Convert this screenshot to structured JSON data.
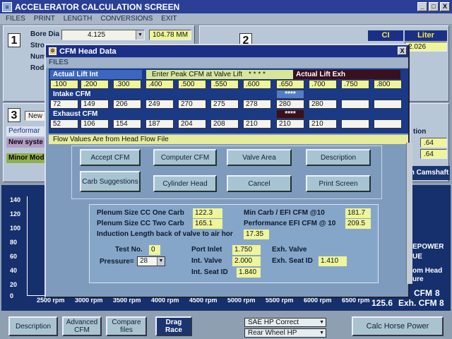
{
  "window": {
    "title": "ACCELERATOR CALCULATION SCREEN",
    "controls": {
      "minimize": "_",
      "maximize": "□",
      "close": "X"
    }
  },
  "menu": [
    "FILES",
    "PRINT",
    "LENGTH",
    "CONVERSIONS",
    "EXIT"
  ],
  "section1": {
    "number": "1",
    "bore_label": "Bore Dia",
    "bore_value": "4.125",
    "bore_mm": "104.78 MM",
    "partial_labels": [
      "Stro",
      "Num",
      "Rod"
    ]
  },
  "section2": {
    "number": "2",
    "ci_header": "CI",
    "liter_header": "Liter",
    "liter_value": "2.026"
  },
  "section3": {
    "number": "3",
    "new_label": "New",
    "tabs": [
      "Performar",
      "New syste"
    ],
    "minor_label": "Minor",
    "mod_label": "Mod"
  },
  "right_panel": {
    "partial_label": "tion",
    "values": [
      ".64",
      ".64"
    ],
    "camshaft_label": "n Camshaft"
  },
  "graph": {
    "y_ticks": [
      "140",
      "120",
      "100",
      "80",
      "60",
      "40",
      "20",
      "0"
    ],
    "x_ticks": [
      "2500 rpm",
      "3000 rpm",
      "3500 rpm",
      "4000 rpm",
      "4500 rpm",
      "5000 rpm",
      "5500 rpm",
      "6000 rpm",
      "6500 rpm"
    ],
    "right_texts": [
      "EPOWER",
      "UE",
      "om Head",
      "ure"
    ],
    "cfm_rows": [
      {
        "label": "CFM",
        "value": "8"
      },
      {
        "num": "125.6",
        "label": "Exh. CFM",
        "value": "8"
      }
    ]
  },
  "bottom_bar": {
    "description": "Description",
    "advanced_cfm": "Advanced CFM",
    "compare_files": "Compare files",
    "drag_race": "Drag Race",
    "sae_select": "SAE HP Correct",
    "wheel_select": "Rear Wheel  HP",
    "calc_hp": "Calc Horse Power"
  },
  "dialog": {
    "title": "CFM Head Data",
    "close": "X",
    "menu": "FILES",
    "flow": {
      "lift_int_label": "Actual Lift Int",
      "prompt": "Enter Peak CFM at Valve Lift",
      "stars": "* * * *",
      "lift_exh_label": "Actual Lift Exh",
      "lifts": [
        ".100",
        ".200",
        ".300",
        ".400",
        ".500",
        ".550",
        ".600",
        ".650",
        ".700",
        ".750",
        ".800"
      ],
      "intake_label": "Intake CFM",
      "intake": [
        "72",
        "149",
        "206",
        "249",
        "270",
        "275",
        "278",
        "280",
        "280",
        "",
        ""
      ],
      "intake_marker": "****",
      "exhaust_label": "Exhaust CFM",
      "exhaust": [
        "52",
        "106",
        "154",
        "187",
        "204",
        "208",
        "210",
        "210",
        "210",
        "",
        ""
      ],
      "exhaust_marker": "****"
    },
    "note": "Flow Values Are from Head Flow File",
    "buttons": {
      "accept": "Accept CFM",
      "computer": "Computer CFM",
      "valve_area": "Valve Area",
      "description": "Description",
      "carb": "Carb Suggestions",
      "cylinder_head": "Cylinder Head",
      "cancel": "Cancel",
      "print": "Print Screen"
    },
    "info": {
      "plenum_one_label": "Plenum Size CC One Carb",
      "plenum_one": "122.3",
      "plenum_two_label": "Plenum Size CC Two Carb",
      "plenum_two": "165.1",
      "min_carb_label": "Min Carb / EFI CFM @10",
      "min_carb": "181.7",
      "perf_efi_label": "Performance EFI CFM @ 10",
      "perf_efi": "209.5",
      "induction_label": "Induction Length back of valve to air hor",
      "induction": "17.35",
      "test_label": "Test No.",
      "test_no": "0",
      "pressure_label": "Pressure=",
      "pressure": "28",
      "port_inlet_label": "Port Inlet",
      "port_inlet": "1.750",
      "int_valve_label": "Int. Valve",
      "int_valve": "2.000",
      "int_seat_label": "Int. Seat ID",
      "int_seat": "1.840",
      "exh_valve_label": "Exh. Valve",
      "exh_seat_label": "Exh. Seat ID",
      "exh_seat": "1.410"
    }
  }
}
